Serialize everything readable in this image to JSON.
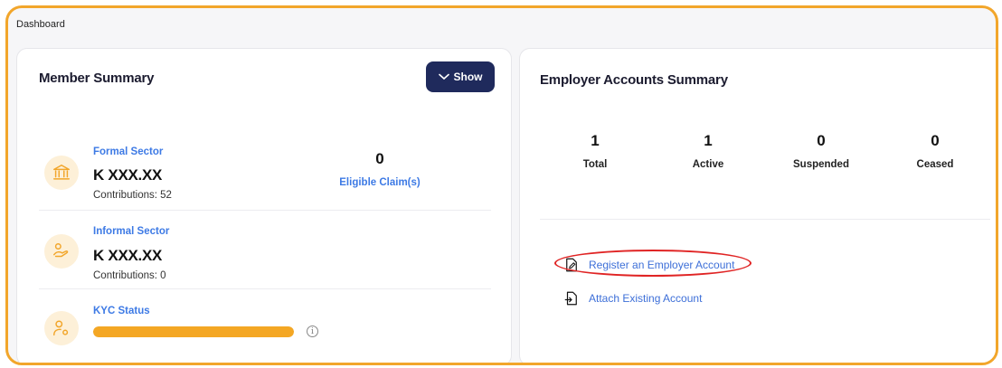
{
  "breadcrumb": "Dashboard",
  "member_summary": {
    "title": "Member Summary",
    "show_button": "Show",
    "formal": {
      "label": "Formal Sector",
      "amount": "K XXX.XX",
      "contributions": "Contributions: 52"
    },
    "claims": {
      "count": "0",
      "label": "Eligible Claim(s)"
    },
    "informal": {
      "label": "Informal Sector",
      "amount": "K XXX.XX",
      "contributions": "Contributions: 0"
    },
    "kyc": {
      "label": "KYC Status",
      "progress_percent": 100,
      "info_glyph": "i"
    }
  },
  "employer_summary": {
    "title": "Employer Accounts Summary",
    "stats": [
      {
        "value": "1",
        "label": "Total"
      },
      {
        "value": "1",
        "label": "Active"
      },
      {
        "value": "0",
        "label": "Suspended"
      },
      {
        "value": "0",
        "label": "Ceased"
      }
    ],
    "actions": {
      "register": "Register an Employer Account",
      "attach": "Attach Existing Account"
    }
  },
  "colors": {
    "accent_orange": "#f2a62b",
    "link_blue": "#3d7ae5",
    "button_navy": "#1f2a5c",
    "highlight_red": "#e02424"
  },
  "icons": {
    "formal": "bank-icon",
    "informal": "hand-coin-icon",
    "kyc": "user-key-icon",
    "register": "edit-document-icon",
    "attach": "file-import-icon",
    "show": "chevron-down-icon"
  }
}
